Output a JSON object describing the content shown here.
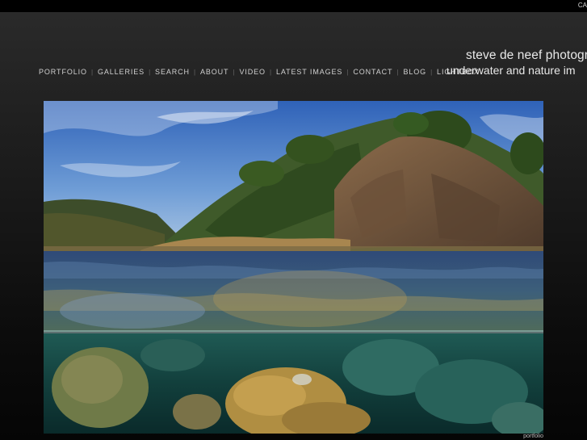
{
  "topbar": {
    "link_label": "CA"
  },
  "header": {
    "title": "steve de neef photogr",
    "subtitle": "underwater and nature im"
  },
  "nav": {
    "items": [
      {
        "label": "PORTFOLIO"
      },
      {
        "label": "GALLERIES"
      },
      {
        "label": "SEARCH"
      },
      {
        "label": "ABOUT"
      },
      {
        "label": "VIDEO"
      },
      {
        "label": "LATEST IMAGES"
      },
      {
        "label": "CONTACT"
      },
      {
        "label": "BLOG"
      },
      {
        "label": "LIGHTBOX"
      }
    ],
    "separator": "|"
  },
  "photo": {
    "caption": "portfolio"
  }
}
